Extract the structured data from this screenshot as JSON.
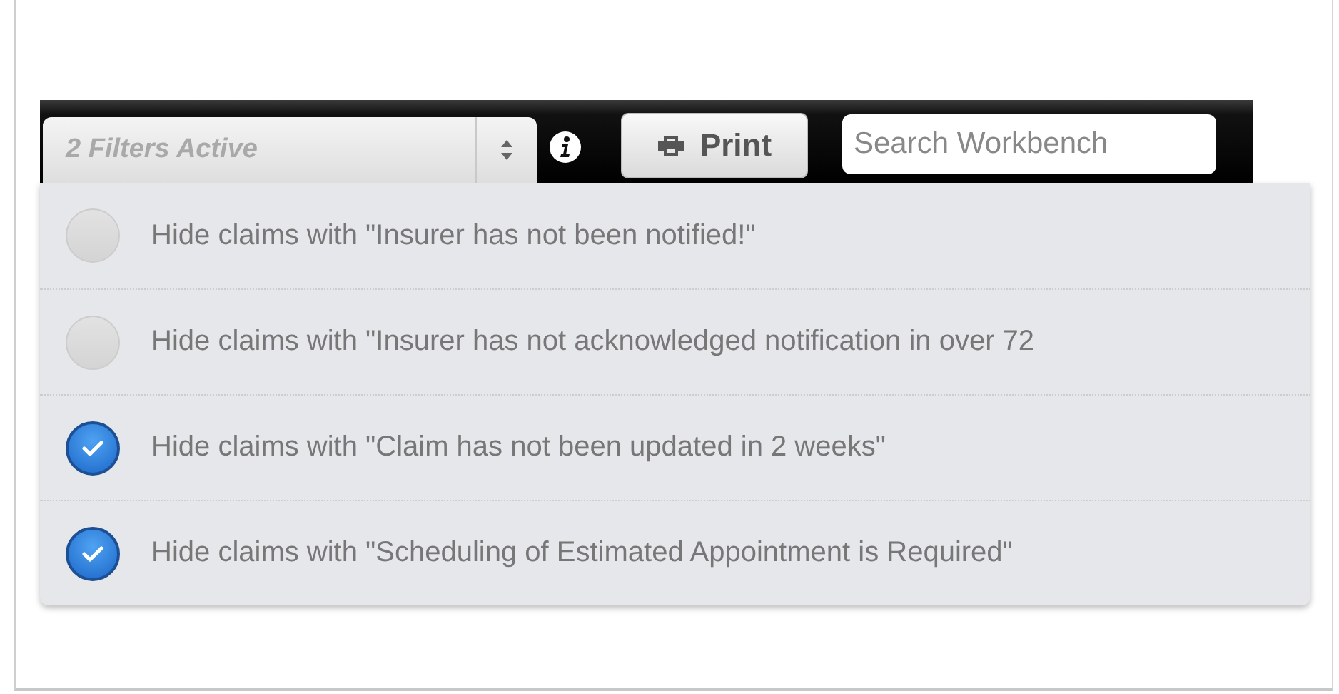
{
  "toolbar": {
    "filter_select": {
      "value": "2 Filters Active"
    },
    "print_button": {
      "label": "Print"
    },
    "search": {
      "placeholder": "Search Workbench"
    }
  },
  "filters": [
    {
      "label": "Hide claims with \"Insurer has not been notified!\"",
      "checked": false
    },
    {
      "label": "Hide claims with \"Insurer has not acknowledged notification in over 72",
      "checked": false
    },
    {
      "label": "Hide claims with \"Claim has not been updated in 2 weeks\"",
      "checked": true
    },
    {
      "label": "Hide claims with \"Scheduling of Estimated Appointment is Required\"",
      "checked": true
    }
  ]
}
